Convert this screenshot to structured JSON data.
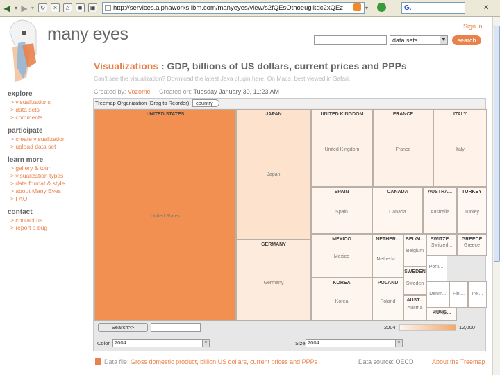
{
  "browser": {
    "url": "http://services.alphaworks.ibm.com/manyeyes/view/s2fQEsOthoeuglkdc2xQEz",
    "search_engine_label": "G."
  },
  "site": {
    "brand": "many eyes",
    "signin_label": "Sign in",
    "search_scope": "data sets",
    "search_button": "search"
  },
  "nav": [
    {
      "heading": "explore",
      "links": [
        "> visualizations",
        "> data sets",
        "> comments"
      ]
    },
    {
      "heading": "participate",
      "links": [
        "> create visualization",
        "> upload data set"
      ]
    },
    {
      "heading": "learn more",
      "links": [
        "> gallery & tour",
        "> visualization types",
        "> data format & style",
        "> about Many Eyes",
        "> FAQ"
      ]
    },
    {
      "heading": "contact",
      "links": [
        "> contact us",
        "> report a bug"
      ]
    }
  ],
  "page": {
    "title_link": "Visualizations",
    "title_rest": " : GDP, billions of US dollars, current prices and PPPs",
    "java_note": "Can't see the visualization? Download the latest Java plugin here. On Macs: best viewed in Safari.",
    "created_by_label": "Created by:",
    "created_by": "Vozome",
    "created_on_label": "Created on:",
    "created_on": "Tuesday January 30, 11:23 AM"
  },
  "visualization": {
    "header_label": "Treemap Organization (Drag to Reorder):",
    "group_chip": "country",
    "search_button": "Search>>",
    "legend_min": "2004",
    "legend_max": "12,000",
    "color_label": "Color",
    "color_value": "2004",
    "size_label": "Size",
    "size_value": "2004",
    "accent": "#e8824a",
    "cells": [
      {
        "id": "us",
        "head": "UNITED STATES",
        "label": "United States",
        "fill": "#f19050"
      },
      {
        "id": "jp",
        "head": "JAPAN",
        "label": "Japan",
        "fill": "#fde3cd"
      },
      {
        "id": "de",
        "head": "GERMANY",
        "label": "Germany",
        "fill": "#fdebde"
      },
      {
        "id": "uk",
        "head": "UNITED KINGDOM",
        "label": "United Kingdom",
        "fill": "#fef2e8"
      },
      {
        "id": "fr",
        "head": "FRANCE",
        "label": "France",
        "fill": "#fef1e7"
      },
      {
        "id": "it",
        "head": "ITALY",
        "label": "Italy",
        "fill": "#fef2e9"
      },
      {
        "id": "es",
        "head": "SPAIN",
        "label": "Spain",
        "fill": "#fef5ee"
      },
      {
        "id": "ca",
        "head": "CANADA",
        "label": "Canada",
        "fill": "#fef6ef"
      },
      {
        "id": "au",
        "head": "AUSTRA...",
        "label": "Australia",
        "fill": "#fef7f1"
      },
      {
        "id": "tr",
        "head": "TURKEY",
        "label": "Turkey",
        "fill": "#fef7f2"
      },
      {
        "id": "mx",
        "head": "MEXICO",
        "label": "Mexico",
        "fill": "#fef5ef"
      },
      {
        "id": "kr",
        "head": "KOREA",
        "label": "Korea",
        "fill": "#fef5ee"
      },
      {
        "id": "nl",
        "head": "NETHER...",
        "label": "Netherla...",
        "fill": "#fef8f3"
      },
      {
        "id": "be",
        "head": "BELGI...",
        "label": "Belgium",
        "fill": "#fef9f5"
      },
      {
        "id": "ch",
        "head": "SWITZE...",
        "label": "Switzerl...",
        "fill": "#fef9f5"
      },
      {
        "id": "gr",
        "head": "GREECE",
        "label": "Greece",
        "fill": "#fef9f5"
      },
      {
        "id": "se",
        "head": "SWEDEN",
        "label": "Sweden",
        "fill": "#fef9f5"
      },
      {
        "id": "pl",
        "head": "POLAND",
        "label": "Poland",
        "fill": "#fef8f3"
      },
      {
        "id": "at",
        "head": "AUST...",
        "label": "Austria",
        "fill": "#fef9f5"
      },
      {
        "id": "hu",
        "head": "HUNG...",
        "label": "Hung...",
        "fill": "#fefaf7"
      },
      {
        "id": "pt",
        "head": "",
        "label": "Portu...",
        "fill": "#ffffff"
      },
      {
        "id": "dk",
        "head": "",
        "label": "Denm...",
        "fill": "#ffffff"
      },
      {
        "id": "fi",
        "head": "",
        "label": "Finl...",
        "fill": "#ffffff"
      },
      {
        "id": "ie",
        "head": "",
        "label": "Irel...",
        "fill": "#ffffff"
      }
    ]
  },
  "footer": {
    "data_file_label": "Data file:",
    "data_file_name": "Gross domestic product, billion US dollars, current prices and PPPs",
    "data_source_label": "Data source:",
    "data_source": "OECD",
    "about_link": "About the Treemap"
  }
}
